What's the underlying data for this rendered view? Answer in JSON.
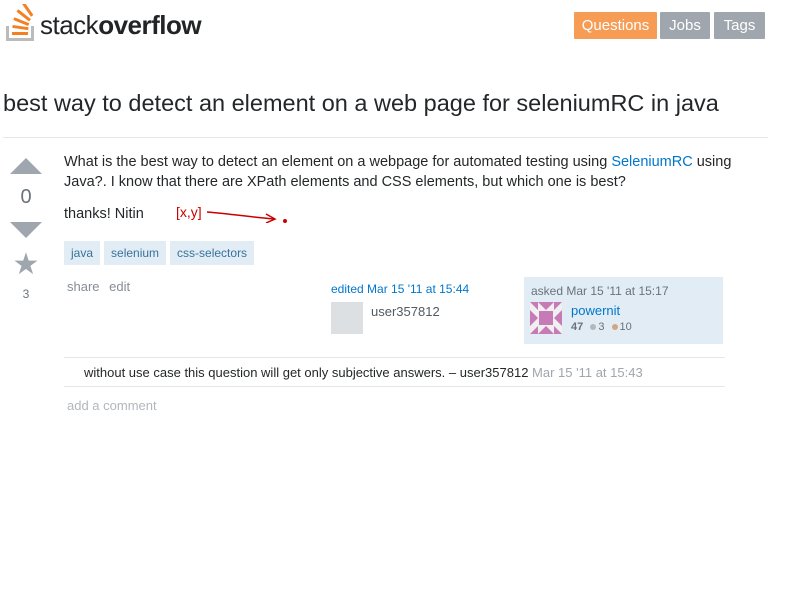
{
  "header": {
    "logo_text_light": "stack",
    "logo_text_bold": "overflow",
    "nav": [
      {
        "label": "Questions"
      },
      {
        "label": "Jobs"
      },
      {
        "label": "Tags"
      }
    ],
    "colors": {
      "accent": "#f69c55",
      "nav_gray": "#9fa6ad"
    }
  },
  "question": {
    "title": "best way to detect an element on a web page for seleniumRC in java",
    "vote_count": "0",
    "favorite_count": "3",
    "body_part1": "What is the best way to detect an element on a webpage for automated testing using ",
    "body_link": "SeleniumRC",
    "body_part2": " using Java?. I know that there are XPath elements and CSS elements, but which one is best?",
    "body_thanks": "thanks! Nitin",
    "annotation": "[x,y]",
    "tags": [
      "java",
      "selenium",
      "css-selectors"
    ],
    "menu": {
      "share": "share",
      "edit": "edit"
    },
    "edited": {
      "label": "edited Mar 15 '11 at 15:44",
      "user": "user357812"
    },
    "asked": {
      "label": "asked Mar 15 '11 at 15:17",
      "user": "powernit",
      "reputation": "47",
      "silver": "3",
      "bronze": "10"
    }
  },
  "comments": [
    {
      "text": "without use case this question will get only subjective answers. – user357812",
      "time": " Mar 15 '11 at 15:43"
    }
  ],
  "add_comment": "add a comment",
  "icons": [
    "stackoverflow-logo-icon",
    "upvote-arrow-icon",
    "downvote-arrow-icon",
    "favorite-star-icon",
    "identicon-avatar-icon"
  ]
}
